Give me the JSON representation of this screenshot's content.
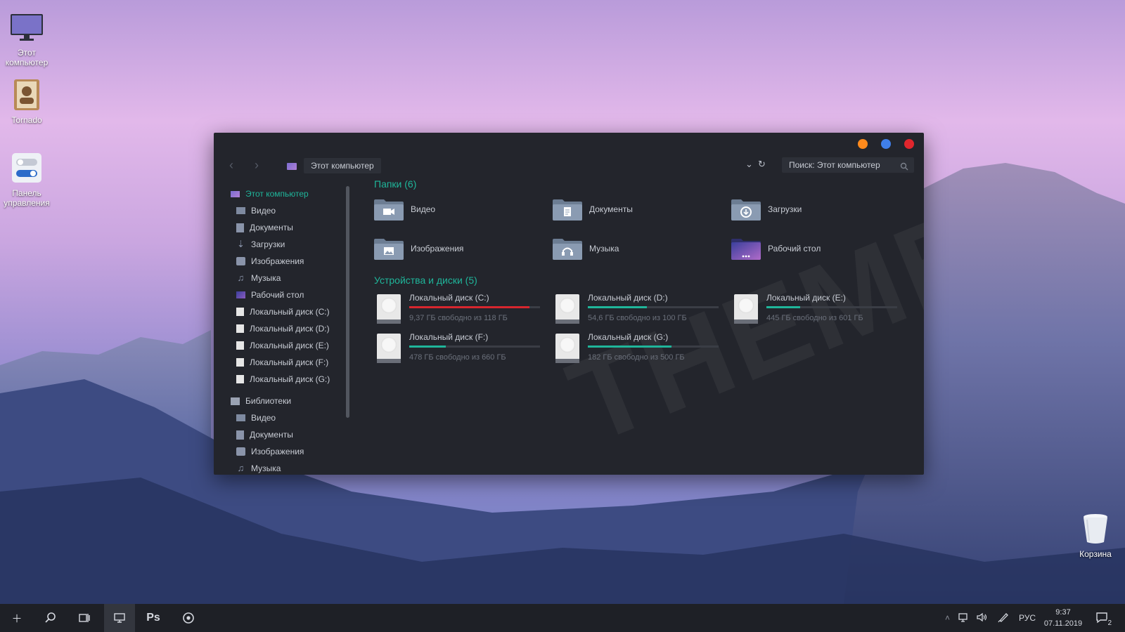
{
  "desktop": {
    "icons": [
      {
        "label": "Этот компьютер"
      },
      {
        "label": "Tornado"
      },
      {
        "label": "Панель управления"
      },
      {
        "label": "Корзина"
      }
    ]
  },
  "window": {
    "buttons": {
      "minimize_color": "#ff8a1c",
      "maximize_color": "#3f7fea",
      "close_color": "#e0262d"
    },
    "address": "Этот компьютер",
    "search_placeholder": "Поиск: Этот компьютер",
    "sidebar": {
      "root": "Этот компьютер",
      "pc_items": [
        "Видео",
        "Документы",
        "Загрузки",
        "Изображения",
        "Музыка",
        "Рабочий стол",
        "Локальный диск (C:)",
        "Локальный диск (D:)",
        "Локальный диск (E:)",
        "Локальный диск (F:)",
        "Локальный диск (G:)"
      ],
      "libraries": "Библиотеки",
      "lib_items": [
        "Видео",
        "Документы",
        "Изображения",
        "Музыка"
      ]
    },
    "folders_title": "Папки (6)",
    "folders": [
      "Видео",
      "Документы",
      "Загрузки",
      "Изображения",
      "Музыка",
      "Рабочий стол"
    ],
    "drives_title": "Устройства и диски (5)",
    "drives": [
      {
        "name": "Локальный диск (C:)",
        "free": "9,37 ГБ свободно из 118 ГБ",
        "used_fraction": 0.92,
        "color": "#d7262e"
      },
      {
        "name": "Локальный диск (D:)",
        "free": "54,6 ГБ свободно из 100 ГБ",
        "used_fraction": 0.45,
        "color": "#1fb59a"
      },
      {
        "name": "Локальный диск (E:)",
        "free": "445 ГБ свободно из 601 ГБ",
        "used_fraction": 0.26,
        "color": "#1fb59a"
      },
      {
        "name": "Локальный диск (F:)",
        "free": "478 ГБ свободно из 660 ГБ",
        "used_fraction": 0.28,
        "color": "#1fb59a"
      },
      {
        "name": "Локальный диск (G:)",
        "free": "182 ГБ свободно из 500 ГБ",
        "used_fraction": 0.64,
        "color": "#1fb59a"
      }
    ],
    "accent": "#1fb59a"
  },
  "taskbar": {
    "ps_label": "Ps",
    "lang": "РУС",
    "time": "9:37",
    "date": "07.11.2019",
    "notif_count": "2"
  }
}
